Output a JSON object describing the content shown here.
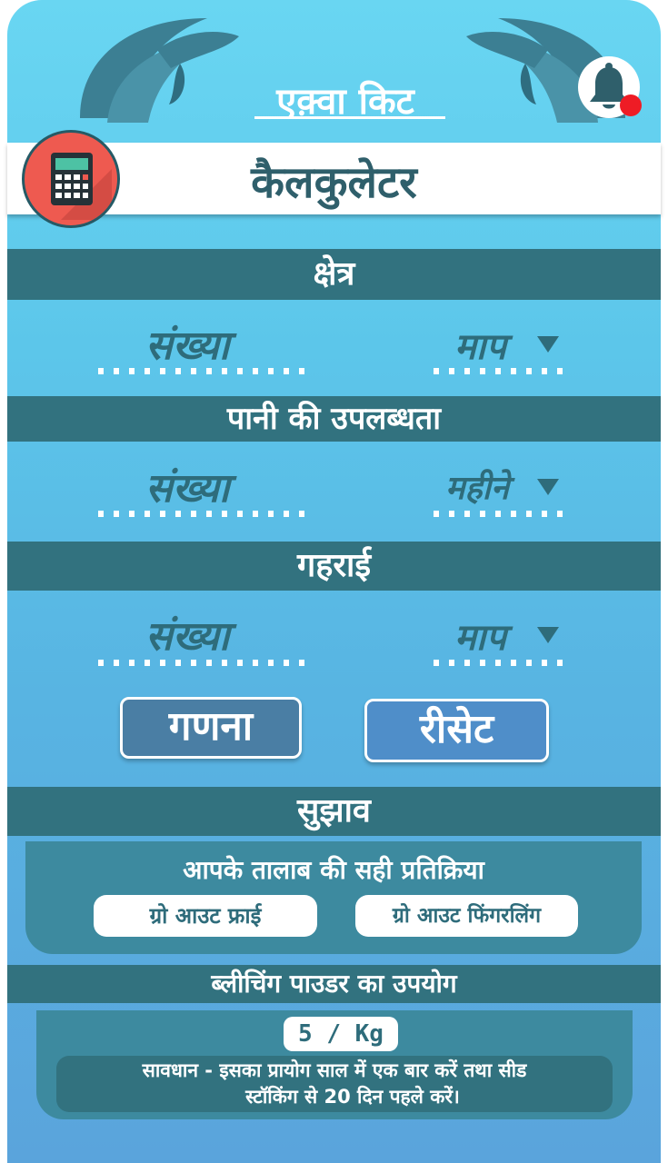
{
  "app": {
    "title": "एक़्वा किट",
    "icons": {
      "calculator": "calculator-icon",
      "bell": "bell-icon"
    },
    "colors": {
      "section_bar": "#32727f",
      "primary_text": "#2e6c7b",
      "notification_dot": "#ee1c25"
    }
  },
  "header": {
    "title": "कैलकुलेटर"
  },
  "sections": {
    "area": {
      "title": "क्षेत्र",
      "number_label": "संख्या",
      "unit_label": "माप"
    },
    "water": {
      "title": "पानी की उपलब्धता",
      "number_label": "संख्या",
      "unit_label": "महीने"
    },
    "depth": {
      "title": "गहराई",
      "number_label": "संख्या",
      "unit_label": "माप"
    }
  },
  "buttons": {
    "calculate": "गणना",
    "reset": "रीसेट"
  },
  "suggestion": {
    "title": "सुझाव",
    "subtitle": "आपके तालाब की सही प्रतिक्रिया",
    "option_fry": "ग्रो आउट फ्राई",
    "option_fingerling": "ग्रो आउट फिंगरलिंग"
  },
  "bleaching": {
    "title": "ब्लीचिंग पाउडर का उपयोग",
    "dose": "5 / Kg",
    "warning_line1": "सावधान - इसका प्रायोग साल में एक बार करें तथा सीड",
    "warning_line2": "स्टॉकिंग से 20 दिन पहले करें।"
  }
}
